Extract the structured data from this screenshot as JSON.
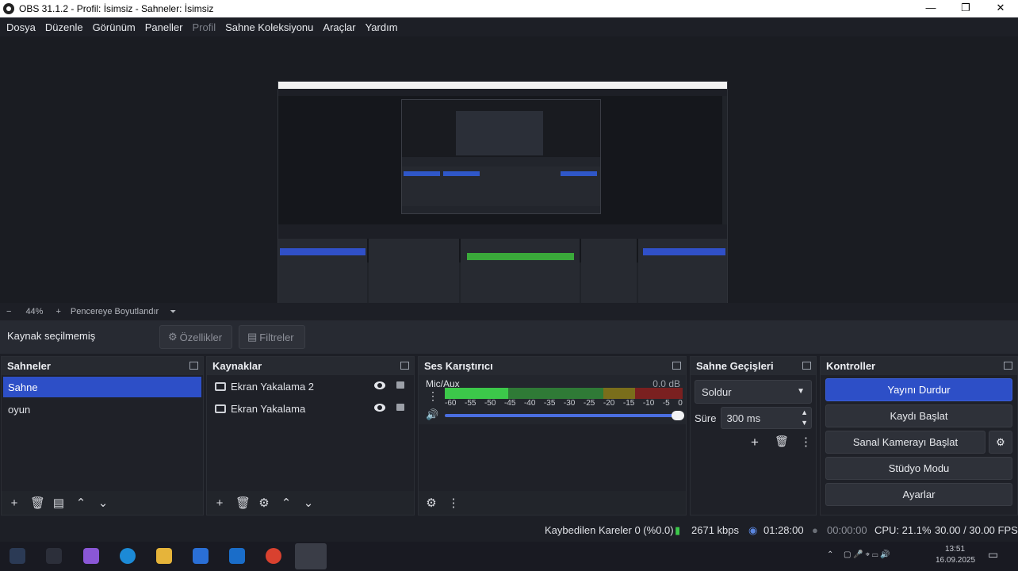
{
  "window": {
    "title": "OBS 31.1.2 - Profil: İsimsiz - Sahneler: İsimsiz",
    "minimize": "—",
    "maximize": "❐",
    "close": "✕"
  },
  "menu": [
    "Dosya",
    "Düzenle",
    "Görünüm",
    "Paneller",
    "Profil",
    "Sahne Koleksiyonu",
    "Araçlar",
    "Yardım"
  ],
  "preview_toolbar": {
    "minus": "−",
    "zoom": "44%",
    "plus": "+",
    "fit_label": "Pencereye Boyutlandır",
    "caret": "⏷"
  },
  "source_bar": {
    "label": "Kaynak seçilmemiş",
    "properties": "Özellikler",
    "filters": "Filtreler"
  },
  "scenes": {
    "title": "Sahneler",
    "items": [
      "Sahne",
      "oyun"
    ]
  },
  "sources": {
    "title": "Kaynaklar",
    "items": [
      "Ekran Yakalama 2",
      "Ekran Yakalama"
    ]
  },
  "mixer": {
    "title": "Ses Karıştırıcı",
    "channel": "Mic/Aux",
    "db": "0.0 dB",
    "ticks": [
      "-60",
      "-55",
      "-50",
      "-45",
      "-40",
      "-35",
      "-30",
      "-25",
      "-20",
      "-15",
      "-10",
      "-5",
      "0"
    ]
  },
  "transitions": {
    "title": "Sahne Geçişleri",
    "selected": "Soldur",
    "duration_label": "Süre",
    "duration_value": "300 ms"
  },
  "controls": {
    "title": "Kontroller",
    "buttons": [
      "Yayını Durdur",
      "Kaydı Başlat",
      "Sanal Kamerayı Başlat",
      "Stüdyo Modu",
      "Ayarlar"
    ]
  },
  "status": {
    "dropped": "Kaybedilen Kareler 0 (%0.0)",
    "bitrate": "2671 kbps",
    "stream_time": "01:28:00",
    "rec_time": "00:00:00",
    "cpu": "CPU: 21.1%",
    "fps": "30.00 / 30.00 FPS"
  },
  "taskbar": {
    "time": "13:51",
    "date": "16.09.2025"
  },
  "colors": {
    "accent": "#2d4fc7",
    "meter_green": "#3cc84a",
    "meter_yellow": "#b7a21f",
    "meter_red": "#a12a2a"
  }
}
